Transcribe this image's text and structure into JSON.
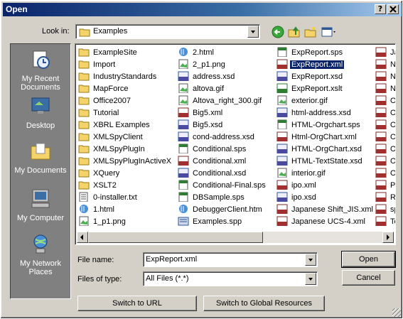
{
  "window": {
    "title": "Open",
    "help_label": "?",
    "close_label": "X"
  },
  "lookin": {
    "label": "Look in:",
    "value": "Examples"
  },
  "places": [
    {
      "label": "My Recent Documents",
      "icon": "recent-documents-icon"
    },
    {
      "label": "Desktop",
      "icon": "desktop-icon"
    },
    {
      "label": "My Documents",
      "icon": "my-documents-icon"
    },
    {
      "label": "My Computer",
      "icon": "my-computer-icon"
    },
    {
      "label": "My Network Places",
      "icon": "network-places-icon"
    }
  ],
  "columns": [
    [
      "ExampleSite",
      "Import",
      "IndustryStandards",
      "MapForce",
      "Office2007",
      "Tutorial",
      "XBRL Examples",
      "XMLSpyClient",
      "XMLSpyPlugIn",
      "XMLSpyPlugInActiveX",
      "XQuery",
      "XSLT2",
      "0-installer.txt",
      "1.html",
      "1_p1.png"
    ],
    [
      "2.html",
      "2_p1.png",
      "address.xsd",
      "altova.gif",
      "Altova_right_300.gif",
      "Big5.xml",
      "Big5.xsd",
      "cond-address.xsd",
      "Conditional.sps",
      "Conditional.xml",
      "Conditional.xsd",
      "Conditional-Final.sps",
      "DBSample.sps",
      "DebuggerClient.htm",
      "Examples.spp"
    ],
    [
      "ExpReport.sps",
      "ExpReport.xml",
      "ExpReport.xsd",
      "ExpReport.xslt",
      "exterior.gif",
      "html-address.xsd",
      "HTML-Orgchart.sps",
      "Html-OrgChart.xml",
      "HTML-OrgChart.xsd",
      "HTML-TextState.xsd",
      "interior.gif",
      "ipo.xml",
      "ipo.xsd",
      "Japanese Shift_JIS.xml",
      "Japanese UCS-4.xml"
    ],
    [
      "Ja",
      "N",
      "N",
      "N",
      "O",
      "O",
      "O",
      "O",
      "O",
      "O",
      "O",
      "Pu",
      "R",
      "sp",
      "Te"
    ]
  ],
  "selected_file": "ExpReport.xml",
  "filename": {
    "label": "File name:",
    "value": "ExpReport.xml"
  },
  "filetype": {
    "label": "Files of type:",
    "value": "All Files (*.*)"
  },
  "buttons": {
    "open": "Open",
    "cancel": "Cancel",
    "switch_url": "Switch to URL",
    "switch_global": "Switch to Global Resources"
  }
}
